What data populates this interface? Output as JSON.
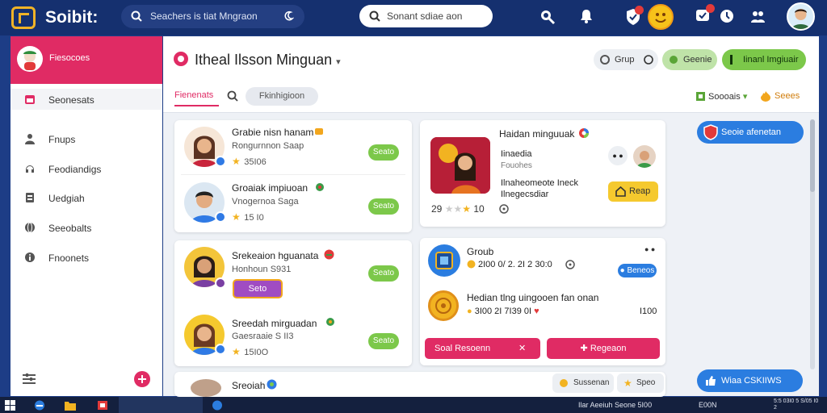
{
  "topbar": {
    "brand": "Soibit:",
    "search_main": "Seachers is tiat Mngraon",
    "search_second": "Sonant sdiae aon",
    "icons": [
      "search-icon",
      "bell-icon",
      "shield-icon",
      "emoji-icon",
      "notification-icon",
      "clock-icon",
      "people-icon"
    ]
  },
  "sidebar": {
    "header_label": "Fiesocoes",
    "items": [
      {
        "label": "Seonesats",
        "icon": "calendar-icon"
      },
      {
        "label": "Fnups",
        "icon": "user-icon"
      },
      {
        "label": "Feodiandigs",
        "icon": "music-icon"
      },
      {
        "label": "Uedgiah",
        "icon": "document-icon"
      },
      {
        "label": "Seeobalts",
        "icon": "globe-icon"
      },
      {
        "label": "Fnoonets",
        "icon": "info-icon"
      }
    ]
  },
  "header": {
    "title": "Itheal Ilsson Minguan",
    "grup_label": "Grup",
    "green_label": "Geenie",
    "cta_label": "Iinanl Imgiuair"
  },
  "subnav": {
    "tab_active": "Fienenats",
    "chip": "Fkinhigioon",
    "settings_label": "Soooais",
    "fire_label": "Seees"
  },
  "people": [
    {
      "name": "Grabie nisn hanam",
      "meta": "Rongurnnon Saap",
      "rating": "35I06",
      "button": "Seato"
    },
    {
      "name": "Groaiak impiuoan",
      "meta": "Vnogernoa Saga",
      "rating": "15 I0",
      "button": "Seato"
    },
    {
      "name": "Srekeaion hguanata",
      "meta": "Honhoun S931",
      "rating": "",
      "button": "Seato",
      "action": "Seto"
    },
    {
      "name": "Sreedah mirguadan",
      "meta": "Gaesraaie S II3",
      "rating": "15I0O",
      "button": "Seato"
    }
  ],
  "feature": {
    "title": "Haidan minguuak",
    "sub1": "Iinaedia",
    "sub2": "Fouohes",
    "sub3": "Ilnaheomeote Ineck",
    "sub4": "Ilnegecsdiar",
    "rating_left": "29",
    "rating_right": "10",
    "action": "Reap"
  },
  "group": {
    "title": "Groub",
    "line1": "2I00 0/ 2. 2I 2 30:0",
    "tag": "Beneos",
    "name2": "Hedian tlng uingooen fan onan",
    "line2": "3I00 2I 7I39 0I",
    "line2_right": "I100",
    "btn_left": "Soal Resoenn",
    "btn_right": "Regeaon"
  },
  "bottom_card": {
    "name": "Sreoiah",
    "pill1": "Sussenan",
    "pill2": "Speo"
  },
  "right_rail": {
    "top_pill": "Seoie afenetan",
    "bottom_pill": "Wiaa CSKIIWS"
  },
  "taskbar": {
    "text1": "Ilar Aeeiuh Seone 5I00",
    "text2": "E00N",
    "clock": "5:5 03I0 5 S/05 I0 2"
  },
  "colors": {
    "accent": "#e02b64",
    "topbar": "#15306f",
    "green": "#7cc84a",
    "blue": "#2b7de0"
  }
}
